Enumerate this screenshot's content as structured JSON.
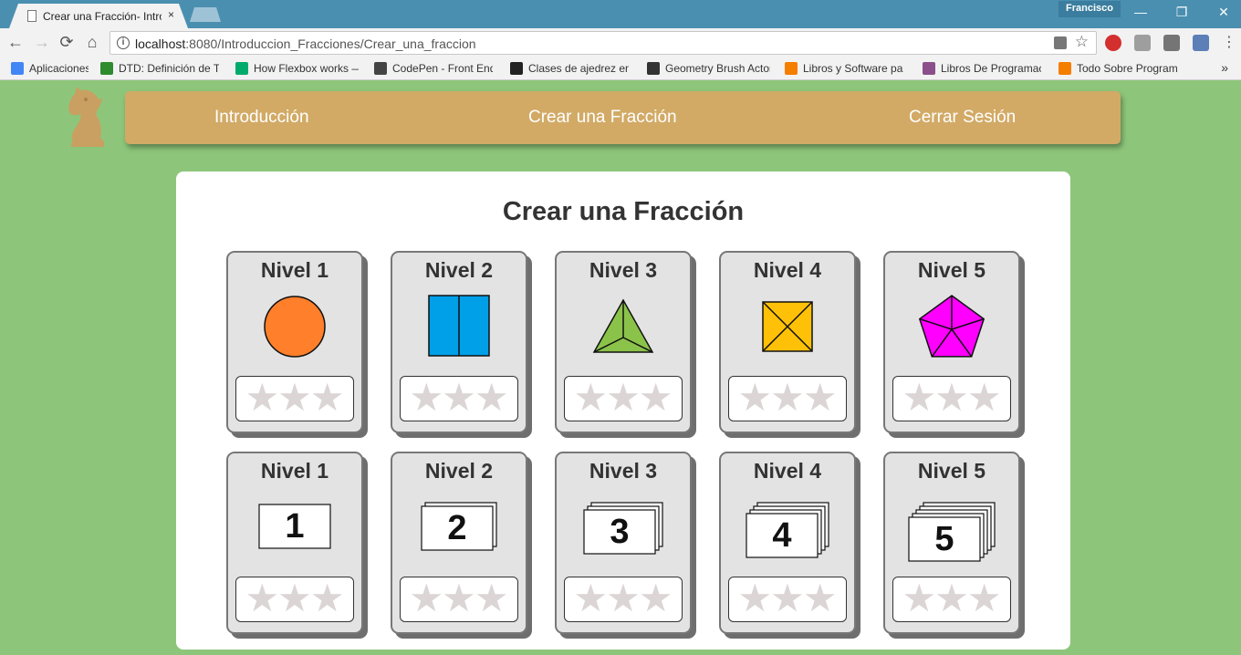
{
  "browser": {
    "tab_title": "Crear una Fracción- Intro",
    "tab_close": "×",
    "profile_name": "Francisco",
    "url_host": "localhost",
    "url_rest": ":8080/Introduccion_Fracciones/Crear_una_fraccion",
    "window_controls": {
      "minimize": "—",
      "restore": "❐",
      "close": "✕"
    },
    "nav": {
      "back": "←",
      "forward": "→",
      "reload": "⟳",
      "home": "⌂"
    },
    "bookmarks": [
      {
        "label": "Aplicaciones",
        "icon": "apps-grid-icon",
        "color": "#4285f4"
      },
      {
        "label": "DTD: Definición de Tip",
        "icon": "checkmark-icon",
        "color": "#2e8b2e"
      },
      {
        "label": "How Flexbox works —",
        "icon": "medium-icon",
        "color": "#00ab6c"
      },
      {
        "label": "CodePen - Front End",
        "icon": "codepen-icon",
        "color": "#444444"
      },
      {
        "label": "Clases de ajedrez en v",
        "icon": "chess-rook-icon",
        "color": "#222222"
      },
      {
        "label": "Geometry Brush Actor",
        "icon": "unreal-icon",
        "color": "#333333"
      },
      {
        "label": "Libros y Software para",
        "icon": "blogger-icon",
        "color": "#f57d00"
      },
      {
        "label": "Libros De Programacio",
        "icon": "podcast-icon",
        "color": "#8b4f8b"
      },
      {
        "label": "Todo Sobre Programa",
        "icon": "blogger-icon",
        "color": "#f57d00"
      }
    ],
    "bookmarks_more": "»"
  },
  "nav": {
    "links": [
      "Introducción",
      "Crear una Fracción",
      "Cerrar Sesión"
    ]
  },
  "main": {
    "title": "Crear una Fracción",
    "star_glyph": "★",
    "shape_levels": [
      {
        "name": "Nivel 1",
        "shape": "circle",
        "color": "#ff7f2a",
        "stars_earned": 0
      },
      {
        "name": "Nivel 2",
        "shape": "rectangle-halves",
        "color": "#00a0e9",
        "stars_earned": 0
      },
      {
        "name": "Nivel 3",
        "shape": "triangle-thirds",
        "color": "#8bc34a",
        "stars_earned": 0
      },
      {
        "name": "Nivel 4",
        "shape": "square-quarters",
        "color": "#ffc107",
        "stars_earned": 0
      },
      {
        "name": "Nivel 5",
        "shape": "pentagon-fifths",
        "color": "#ff00ff",
        "stars_earned": 0
      }
    ],
    "card_levels": [
      {
        "name": "Nivel 1",
        "number": "1",
        "stars_earned": 0
      },
      {
        "name": "Nivel 2",
        "number": "2",
        "stars_earned": 0
      },
      {
        "name": "Nivel 3",
        "number": "3",
        "stars_earned": 0
      },
      {
        "name": "Nivel 4",
        "number": "4",
        "stars_earned": 0
      },
      {
        "name": "Nivel 5",
        "number": "5",
        "stars_earned": 0
      }
    ]
  }
}
